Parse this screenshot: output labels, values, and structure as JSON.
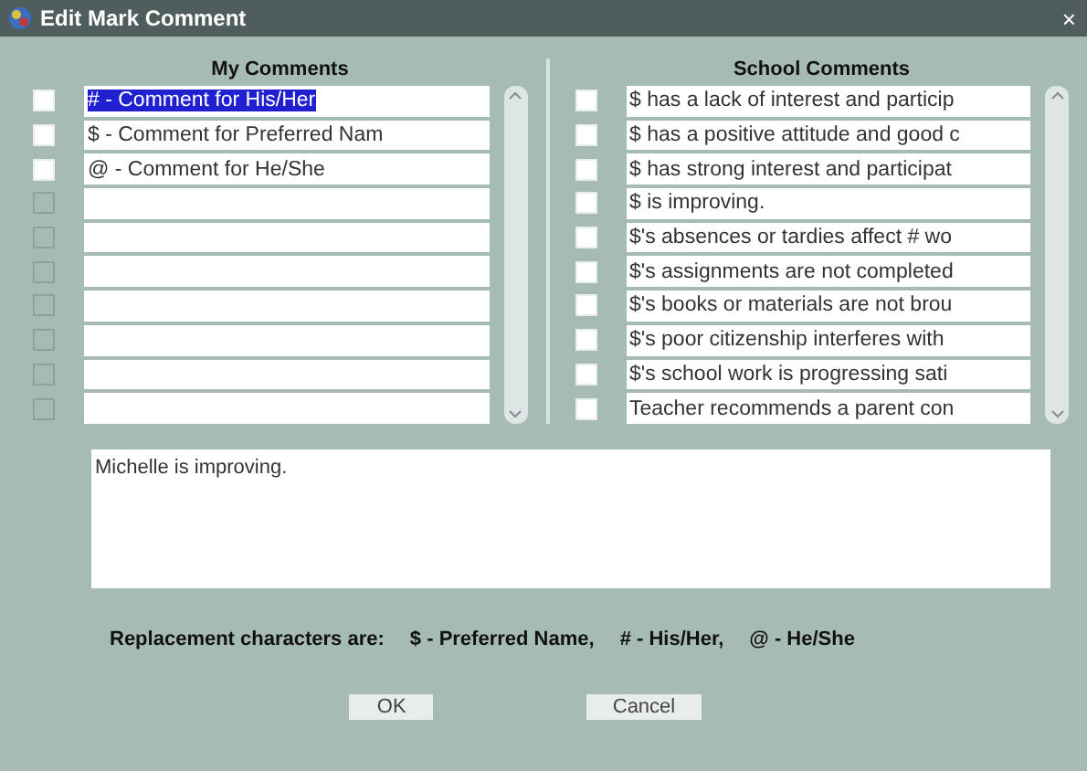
{
  "window": {
    "title": "Edit Mark Comment",
    "close": "×"
  },
  "my_comments": {
    "heading": "My Comments",
    "rows": [
      {
        "text": "# - Comment for His/Her",
        "checked": false,
        "disabled": false,
        "selected": true
      },
      {
        "text": "$ - Comment for Preferred Nam",
        "checked": false,
        "disabled": false,
        "selected": false
      },
      {
        "text": "@ - Comment for He/She",
        "checked": false,
        "disabled": false,
        "selected": false
      },
      {
        "checked": false,
        "disabled": true,
        "selected": false
      },
      {
        "checked": false,
        "disabled": true,
        "selected": false
      },
      {
        "checked": false,
        "disabled": true,
        "selected": false
      },
      {
        "checked": false,
        "disabled": true,
        "selected": false
      },
      {
        "checked": false,
        "disabled": true,
        "selected": false
      },
      {
        "checked": false,
        "disabled": true,
        "selected": false
      },
      {
        "checked": false,
        "disabled": true,
        "selected": false
      }
    ]
  },
  "school_comments": {
    "heading": "School Comments",
    "rows": [
      {
        "text": "$ has a lack of interest and particip",
        "checked": false,
        "disabled": false,
        "selected": false
      },
      {
        "text": "$ has a positive attitude and good c",
        "checked": false,
        "disabled": false,
        "selected": false
      },
      {
        "text": "$ has strong interest and participat",
        "checked": false,
        "disabled": false,
        "selected": false
      },
      {
        "text": "$ is improving.",
        "checked": false,
        "disabled": false,
        "selected": false
      },
      {
        "text": "$'s absences or tardies affect # wo",
        "checked": false,
        "disabled": false,
        "selected": false
      },
      {
        "text": "$'s assignments are not completed",
        "checked": false,
        "disabled": false,
        "selected": false
      },
      {
        "text": "$'s books or materials are not brou",
        "checked": false,
        "disabled": false,
        "selected": false
      },
      {
        "text": "$'s poor citizenship interferes with",
        "checked": false,
        "disabled": false,
        "selected": false
      },
      {
        "text": "$'s school work is progressing sati",
        "checked": false,
        "disabled": false,
        "selected": false
      },
      {
        "text": "Teacher recommends a parent con",
        "checked": false,
        "disabled": false,
        "selected": false
      }
    ]
  },
  "comment_text": {
    "value": "Michelle is improving."
  },
  "replacement": {
    "label": "Replacement characters are:",
    "items": [
      "$ - Preferred Name,",
      "# - His/Her,",
      "@ - He/She"
    ]
  },
  "buttons": [
    "OK",
    "Cancel"
  ]
}
